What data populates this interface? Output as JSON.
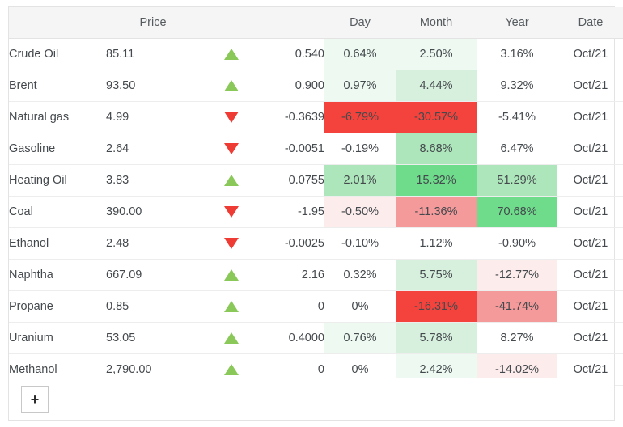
{
  "table": {
    "columns": [
      {
        "key": "name",
        "label": ""
      },
      {
        "key": "price",
        "label": "Price"
      },
      {
        "key": "arrow",
        "label": ""
      },
      {
        "key": "chg",
        "label": ""
      },
      {
        "key": "day",
        "label": "Day"
      },
      {
        "key": "month",
        "label": "Month"
      },
      {
        "key": "year",
        "label": "Year"
      },
      {
        "key": "date",
        "label": "Date"
      }
    ],
    "rows": [
      {
        "name": "Crude Oil",
        "price": "85.11",
        "direction": "up",
        "direction_icon": "triangle-up-icon",
        "change": "0.540",
        "day": "0.64%",
        "day_heat": "hm-g1",
        "month": "2.50%",
        "month_heat": "hm-g1",
        "year": "3.16%",
        "year_heat": "hm-0",
        "date": "Oct/21"
      },
      {
        "name": "Brent",
        "price": "93.50",
        "direction": "up",
        "direction_icon": "triangle-up-icon",
        "change": "0.900",
        "day": "0.97%",
        "day_heat": "hm-g1",
        "month": "4.44%",
        "month_heat": "hm-g2",
        "year": "9.32%",
        "year_heat": "hm-0",
        "date": "Oct/21"
      },
      {
        "name": "Natural gas",
        "price": "4.99",
        "direction": "down",
        "direction_icon": "triangle-down-icon",
        "change": "-0.3639",
        "day": "-6.79%",
        "day_heat": "hm-r4",
        "month": "-30.57%",
        "month_heat": "hm-r4",
        "year": "-5.41%",
        "year_heat": "hm-0",
        "date": "Oct/21"
      },
      {
        "name": "Gasoline",
        "price": "2.64",
        "direction": "down",
        "direction_icon": "triangle-down-icon",
        "change": "-0.0051",
        "day": "-0.19%",
        "day_heat": "hm-0",
        "month": "8.68%",
        "month_heat": "hm-g3",
        "year": "6.47%",
        "year_heat": "hm-0",
        "date": "Oct/21"
      },
      {
        "name": "Heating Oil",
        "price": "3.83",
        "direction": "up",
        "direction_icon": "triangle-up-icon",
        "change": "0.0755",
        "day": "2.01%",
        "day_heat": "hm-g3",
        "month": "15.32%",
        "month_heat": "hm-g4",
        "year": "51.29%",
        "year_heat": "hm-g3",
        "date": "Oct/21"
      },
      {
        "name": "Coal",
        "price": "390.00",
        "direction": "down",
        "direction_icon": "triangle-down-icon",
        "change": "-1.95",
        "day": "-0.50%",
        "day_heat": "hm-r1",
        "month": "-11.36%",
        "month_heat": "hm-r3",
        "year": "70.68%",
        "year_heat": "hm-g4",
        "date": "Oct/21"
      },
      {
        "name": "Ethanol",
        "price": "2.48",
        "direction": "down",
        "direction_icon": "triangle-down-icon",
        "change": "-0.0025",
        "day": "-0.10%",
        "day_heat": "hm-0",
        "month": "1.12%",
        "month_heat": "hm-0",
        "year": "-0.90%",
        "year_heat": "hm-0",
        "date": "Oct/21"
      },
      {
        "name": "Naphtha",
        "price": "667.09",
        "direction": "up",
        "direction_icon": "triangle-up-icon",
        "change": "2.16",
        "day": "0.32%",
        "day_heat": "hm-0",
        "month": "5.75%",
        "month_heat": "hm-g2",
        "year": "-12.77%",
        "year_heat": "hm-r1",
        "date": "Oct/21"
      },
      {
        "name": "Propane",
        "price": "0.85",
        "direction": "up",
        "direction_icon": "triangle-up-icon",
        "change": "0",
        "day": "0%",
        "day_heat": "hm-0",
        "month": "-16.31%",
        "month_heat": "hm-r4",
        "year": "-41.74%",
        "year_heat": "hm-r3",
        "date": "Oct/21"
      },
      {
        "name": "Uranium",
        "price": "53.05",
        "direction": "up",
        "direction_icon": "triangle-up-icon",
        "change": "0.4000",
        "day": "0.76%",
        "day_heat": "hm-g1",
        "month": "5.78%",
        "month_heat": "hm-g2",
        "year": "8.27%",
        "year_heat": "hm-0",
        "date": "Oct/21"
      },
      {
        "name": "Methanol",
        "price": "2,790.00",
        "direction": "up",
        "direction_icon": "triangle-up-icon",
        "change": "0",
        "day": "0%",
        "day_heat": "hm-0",
        "month": "2.42%",
        "month_heat": "hm-g1",
        "year": "-14.02%",
        "year_heat": "hm-r1",
        "date": "Oct/21"
      }
    ]
  },
  "footer": {
    "add_button_label": "+",
    "add_button_icon": "plus-icon"
  },
  "colors": {
    "up_arrow": "#8ac85a",
    "down_arrow": "#ee3b33",
    "header_bg": "#f5f5f5",
    "border": "#e3e3e3",
    "text": "#44494d",
    "heat_green_strong": "#6fdc8c",
    "heat_green_mid": "#aee6bb",
    "heat_green_light": "#d7f0dd",
    "heat_green_faint": "#eef9f1",
    "heat_red_strong": "#f4433c",
    "heat_red_mid": "#f59a9a",
    "heat_red_light": "#fbdddd",
    "heat_red_faint": "#fdecec"
  }
}
